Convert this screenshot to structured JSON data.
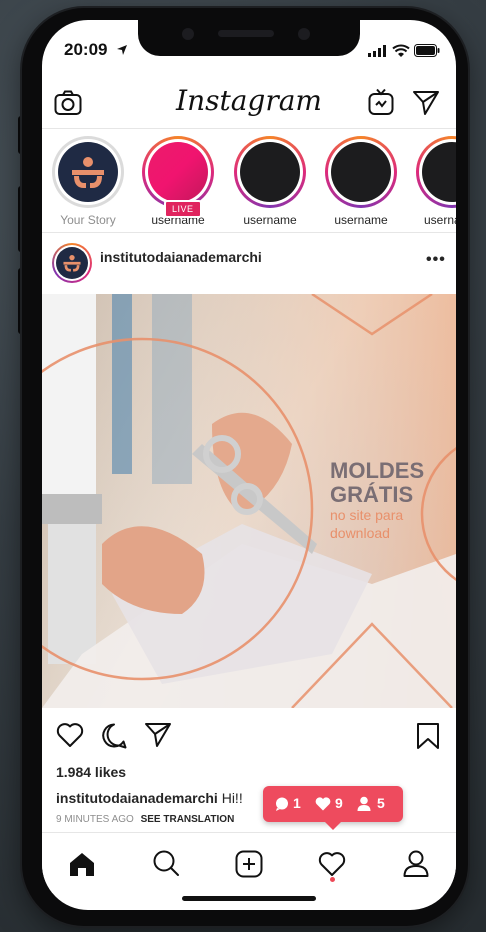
{
  "status": {
    "time": "20:09"
  },
  "app": {
    "title": "Instagram"
  },
  "stories": [
    {
      "label": "Your Story",
      "live": false
    },
    {
      "label": "username",
      "live": true,
      "badge": "LIVE"
    },
    {
      "label": "username",
      "live": false
    },
    {
      "label": "username",
      "live": false
    },
    {
      "label": "userna",
      "live": false
    }
  ],
  "post": {
    "username": "institutodaianademarchi",
    "image": {
      "headline1": "MOLDES",
      "headline2": "GRÁTIS",
      "subline1": "no site para",
      "subline2": "download"
    },
    "likes": "1.984 likes",
    "caption_user": "institutodaianademarchi",
    "caption_text": "Hi!!",
    "time_ago": "9 MINUTES AGO",
    "see_translation": "SEE TRANSLATION"
  },
  "notification": {
    "comments": "1",
    "likes": "9",
    "followers": "5"
  },
  "colors": {
    "accent": "#ee4b5e",
    "brand_orange": "#e8906b",
    "gradient_start": "#f58529",
    "gradient_mid": "#dd2a7b",
    "gradient_end": "#8134af"
  },
  "icons": [
    "camera-icon",
    "igtv-icon",
    "direct-icon",
    "heart-icon",
    "comment-icon",
    "share-icon",
    "bookmark-icon",
    "home-icon",
    "search-icon",
    "add-icon",
    "activity-icon",
    "profile-icon"
  ]
}
